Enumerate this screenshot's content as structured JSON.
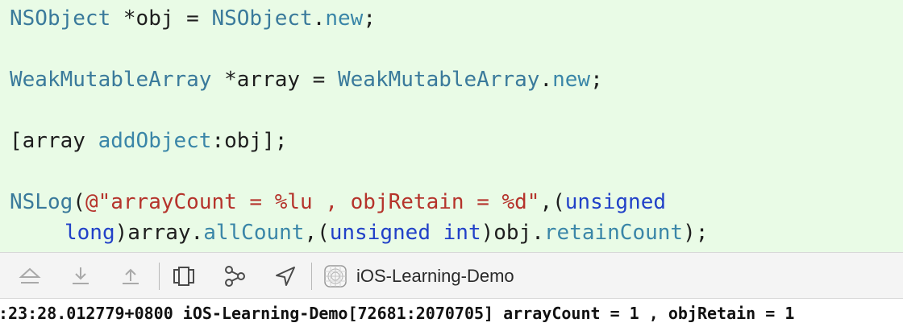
{
  "code": {
    "line1": {
      "type": "NSObject",
      "decl": " *obj = ",
      "rhs_type": "NSObject",
      "dot": ".",
      "method": "new",
      "end": ";"
    },
    "line2": {
      "type": "WeakMutableArray",
      "decl": " *array = ",
      "rhs_type": "WeakMutableArray",
      "dot": ".",
      "method": "new",
      "end": ";"
    },
    "line3": {
      "open": "[array ",
      "method": "addObject",
      "rest": ":obj];"
    },
    "line4": {
      "func": "NSLog",
      "paren": "(",
      "string": "@\"arrayCount = %lu , objRetain = %d\"",
      "comma": ",(",
      "kw": "unsigned"
    },
    "line5": {
      "kw1": "long",
      "a": ")array.",
      "prop1": "allCount",
      "b": ",(",
      "kw2": "unsigned",
      "sp": " ",
      "kw3": "int",
      "c": ")obj.",
      "prop2": "retainCount",
      "d": ");"
    }
  },
  "toolbar": {
    "icons": [
      "hide-panel-icon",
      "step-over-icon",
      "step-out-icon",
      "view-hierarchy-icon",
      "memory-graph-icon",
      "location-icon",
      "app-target-icon"
    ],
    "target_name": "iOS-Learning-Demo"
  },
  "console": {
    "line": ":23:28.012779+0800 iOS-Learning-Demo[72681:2070705] arrayCount = 1 , objRetain = 1"
  },
  "colors": {
    "editor_bg": "#e9fbe6",
    "type": "#3a7a9b",
    "string": "#b5332b",
    "keyword": "#2141c8"
  }
}
